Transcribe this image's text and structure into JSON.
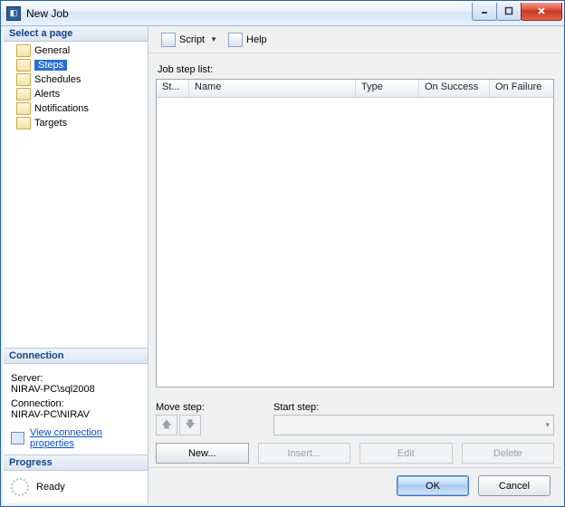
{
  "window": {
    "title": "New Job"
  },
  "left": {
    "select_page": "Select a page",
    "pages": [
      {
        "label": "General"
      },
      {
        "label": "Steps"
      },
      {
        "label": "Schedules"
      },
      {
        "label": "Alerts"
      },
      {
        "label": "Notifications"
      },
      {
        "label": "Targets"
      }
    ],
    "selected_index": 1,
    "connection_head": "Connection",
    "server_label": "Server:",
    "server_value": "NIRAV-PC\\sql2008",
    "conn_label": "Connection:",
    "conn_value": "NIRAV-PC\\NIRAV",
    "view_conn_link": "View connection properties",
    "progress_head": "Progress",
    "progress_status": "Ready"
  },
  "toolbar": {
    "script": "Script",
    "help": "Help"
  },
  "main": {
    "list_label": "Job step list:",
    "columns": {
      "step": "St...",
      "name": "Name",
      "type": "Type",
      "on_success": "On Success",
      "on_failure": "On Failure"
    },
    "move_label": "Move step:",
    "start_label": "Start step:",
    "buttons": {
      "new": "New...",
      "insert": "Insert...",
      "edit": "Edit",
      "delete": "Delete"
    }
  },
  "footer": {
    "ok": "OK",
    "cancel": "Cancel"
  }
}
